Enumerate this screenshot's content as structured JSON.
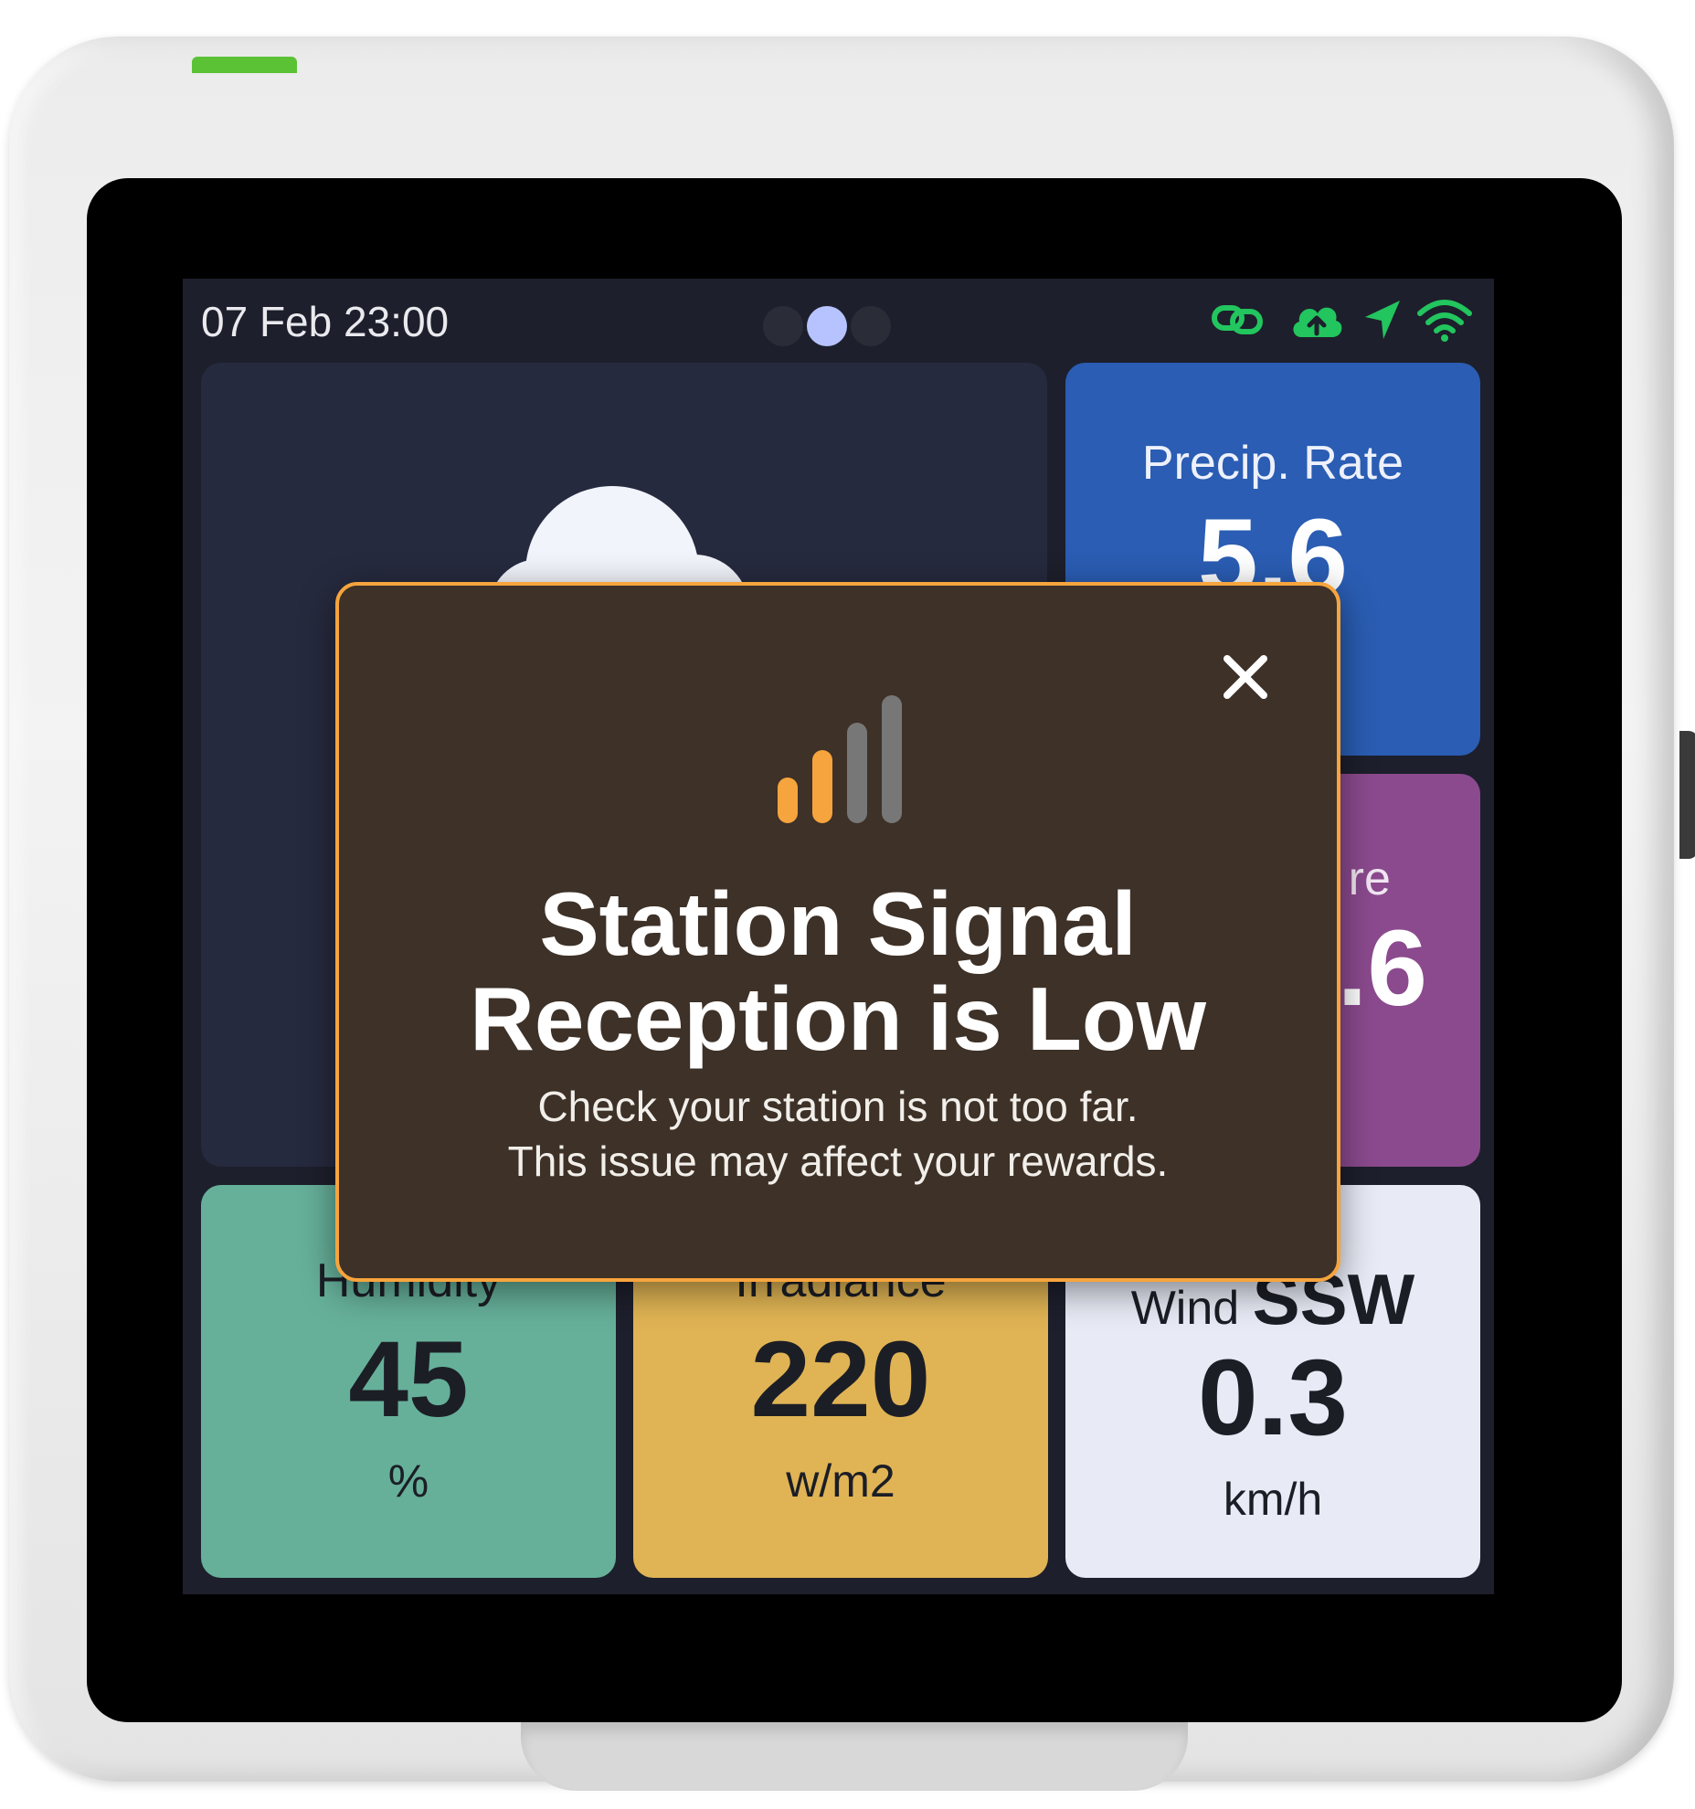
{
  "status_bar": {
    "datetime": "07 Feb 23:00",
    "page_indicator": {
      "count": 3,
      "active_index": 1
    },
    "icons": [
      "link-icon",
      "cloud-upload-icon",
      "location-arrow-icon",
      "wifi-icon"
    ],
    "icon_color": "#22c55e"
  },
  "tiles": {
    "weather": {
      "icon": "cloud-icon"
    },
    "precip": {
      "label": "Precip. Rate",
      "value": "5.6"
    },
    "temperature": {
      "label": "re",
      "value": ".6"
    },
    "humidity": {
      "label": "Humidity",
      "value": "45",
      "unit": "%"
    },
    "irradiance": {
      "label": "Irradiance",
      "value": "220",
      "unit": "w/m2"
    },
    "wind": {
      "label": "Wind",
      "direction": "SSW",
      "value": "0.3",
      "unit": "km/h"
    }
  },
  "modal": {
    "icon": "signal-strength-low-icon",
    "signal_level": 0.5,
    "title_line1": "Station Signal",
    "title_line2": "Reception is Low",
    "message_line1": "Check your station is not too far.",
    "message_line2": "This issue may affect your rewards.",
    "close_icon": "close-icon",
    "accent_color": "#f6a43d"
  }
}
